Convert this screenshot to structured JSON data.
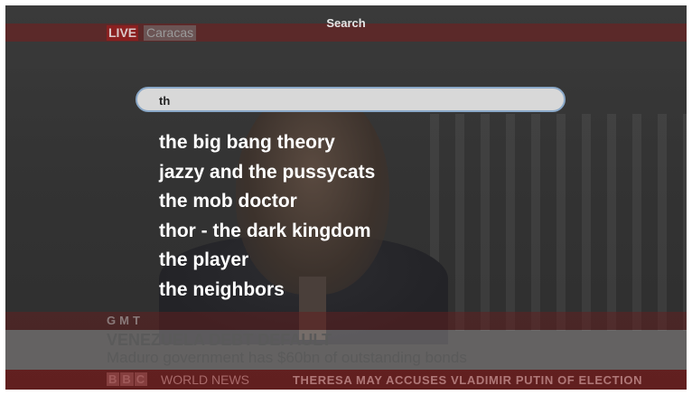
{
  "header": {
    "title": "Search"
  },
  "overlay": {
    "live_label": "LIVE",
    "location": "Caracas",
    "gmt_label": "GMT",
    "headline": "VENEZUELA DEBT DEFAULT",
    "subline": "Maduro government has $60bn of outstanding bonds",
    "channel_logo": "BBC",
    "channel_name": "WORLD NEWS",
    "ticker": "THERESA MAY ACCUSES VLADIMIR PUTIN OF ELECTION"
  },
  "search": {
    "value": "th"
  },
  "results": [
    "the big bang theory",
    "jazzy and the pussycats",
    "the mob doctor",
    "thor - the dark kingdom",
    "the player",
    "the neighbors"
  ],
  "colors": {
    "search_border": "#8aa8c8",
    "result_text": "#ffffff"
  }
}
